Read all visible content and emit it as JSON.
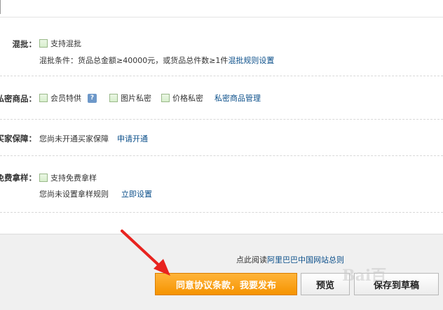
{
  "mixed_batch": {
    "label": "混批：",
    "checkbox_label": "支持混批",
    "condition_text": "混批条件：货品总金额≥40000元，或货品总件数≥1件",
    "rules_link": "混批规则设置"
  },
  "private_goods": {
    "label": "私密商品：",
    "member_checkbox": "会员特供",
    "help_glyph": "?",
    "image_checkbox": "图片私密",
    "price_checkbox": "价格私密",
    "manage_link": "私密商品管理"
  },
  "buyer_guarantee": {
    "label": "买家保障：",
    "status_text": "您尚未开通买家保障",
    "apply_link": "申请开通"
  },
  "free_sample": {
    "label": "免费拿样：",
    "checkbox_label": "支持免费拿样",
    "status_text": "您尚未设置拿样规则",
    "setup_link": "立即设置"
  },
  "footer": {
    "rules_prefix": "点此阅读",
    "rules_link": "阿里巴巴中国网站总则",
    "publish_button": "同意协议条款，我要发布",
    "preview_button": "预览",
    "draft_button": "保存到草稿"
  },
  "watermark": "Bai百"
}
